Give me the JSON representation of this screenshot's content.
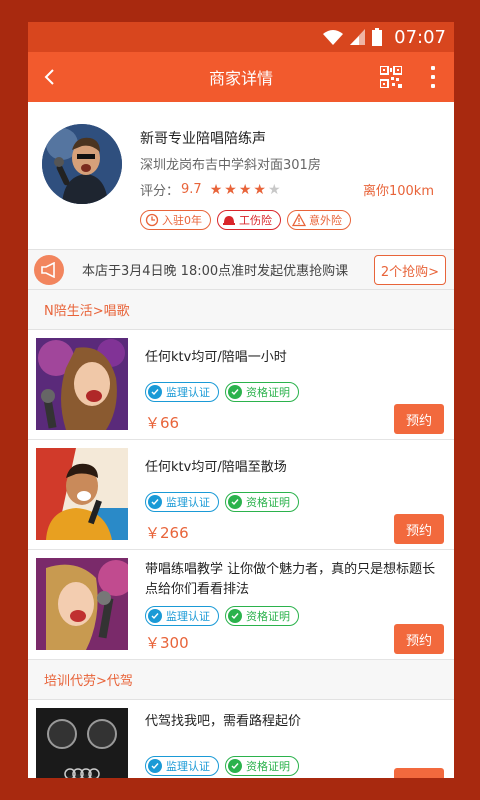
{
  "status": {
    "time": "07:07"
  },
  "header": {
    "title": "商家详情"
  },
  "merchant": {
    "name": "新哥专业陪唱陪练声",
    "address": "深圳龙岗布吉中学斜对面301房",
    "rating_label": "评分：",
    "score": "9.7",
    "stars_filled": 4,
    "stars_total": 5,
    "distance": "离你100km",
    "tags": [
      "入驻0年",
      "工伤险",
      "意外险"
    ]
  },
  "notice": {
    "text": "本店于3月4日晚 18:00点准时发起优惠抢购课",
    "button": "2个抢购>"
  },
  "sections": [
    {
      "title": "N陪生活>唱歌"
    },
    {
      "title": "培训代劳>代驾"
    }
  ],
  "items": [
    {
      "title": "任何ktv均可/陪唱一小时",
      "badge1": "监理认证",
      "badge2": "资格证明",
      "price": "￥66",
      "button": "预约"
    },
    {
      "title": "任何ktv均可/陪唱至散场",
      "badge1": "监理认证",
      "badge2": "资格证明",
      "price": "￥266",
      "button": "预约"
    },
    {
      "title": "带唱练唱教学 让你做个魅力者，真的只是想标题长点给你们看看排法",
      "badge1": "监理认证",
      "badge2": "资格证明",
      "price": "￥300",
      "button": "预约"
    },
    {
      "title": "代驾找我吧，需看路程起价",
      "badge1": "监理认证",
      "badge2": "资格证明",
      "price": "",
      "button": ""
    }
  ],
  "colors": {
    "accent": "#f25a2d",
    "frame": "#a8290f",
    "blue_badge": "#1a9ad6",
    "green_badge": "#2bb24c"
  }
}
